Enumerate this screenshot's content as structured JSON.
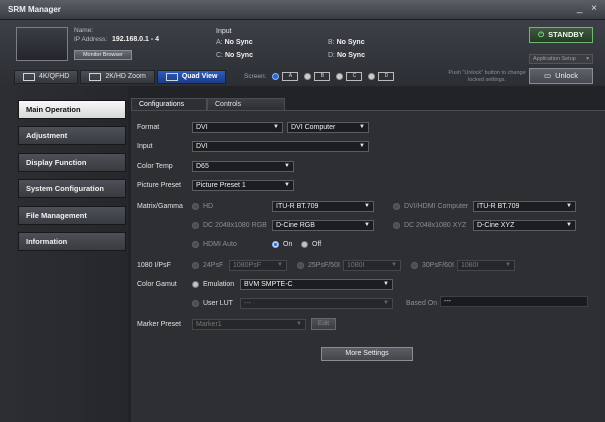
{
  "window": {
    "title": "SRM Manager",
    "minimize": "_",
    "close": "×"
  },
  "device": {
    "name_label": "Name:",
    "ip_label": "IP Address:",
    "ip_value": "192.168.0.1 - 4",
    "monitor_browser": "Monitor Browser"
  },
  "input_status": {
    "label": "Input",
    "a_label": "A:",
    "a_value": "No Sync",
    "b_label": "B:",
    "b_value": "No Sync",
    "c_label": "C:",
    "c_value": "No Sync",
    "d_label": "D:",
    "d_value": "No Sync"
  },
  "controls": {
    "standby": "STANDBY",
    "app_setup": "Application Setup",
    "unlock_hint": "Push \"Unlock\" button to change locked settings.",
    "unlock": "Unlock"
  },
  "view_tabs": [
    {
      "label": "4K/QFHD",
      "active": false
    },
    {
      "label": "2K/HD Zoom",
      "active": false
    },
    {
      "label": "Quad View",
      "active": true
    }
  ],
  "screen": {
    "label": "Screen:",
    "options": [
      "A",
      "B",
      "C",
      "D"
    ],
    "selected": "A"
  },
  "sidebar": {
    "items": [
      {
        "label": "Main Operation",
        "active": true
      },
      {
        "label": "Adjustment",
        "active": false
      },
      {
        "label": "Display Function",
        "active": false
      },
      {
        "label": "System Configuration",
        "active": false
      },
      {
        "label": "File Management",
        "active": false
      },
      {
        "label": "Information",
        "active": false
      }
    ]
  },
  "tabs": [
    {
      "label": "Configurations",
      "active": true
    },
    {
      "label": "Controls",
      "active": false
    }
  ],
  "form": {
    "format_label": "Format",
    "format_value": "DVI",
    "format_sub_value": "DVI Computer",
    "input_label": "Input",
    "input_value": "DVI",
    "colortemp_label": "Color Temp",
    "colortemp_value": "D65",
    "preset_label": "Picture Preset",
    "preset_value": "Picture Preset 1",
    "matrix_label": "Matrix/Gamma",
    "hd_label": "HD",
    "hd_value": "ITU-R BT.709",
    "dvihdmi_label": "DVI/HDMI Computer",
    "dvihdmi_value": "ITU-R BT.709",
    "dc_rgb_label": "DC 2048x1080 RGB",
    "dc_rgb_value": "D-Cine RGB",
    "dc_xyz_label": "DC 2048x1080 XYZ",
    "dc_xyz_value": "D-Cine XYZ",
    "hdmi_auto_label": "HDMI Auto",
    "on_label": "On",
    "off_label": "Off",
    "psf_label": "1080 I/PsF",
    "psf24_label": "24PsF",
    "psf24_value": "1080PsF",
    "psf25_label": "25PsF/50I",
    "psf25_value": "1080I",
    "psf30_label": "30PsF/60I",
    "psf30_value": "1080I",
    "gamut_label": "Color Gamut",
    "emulation_label": "Emulation",
    "emulation_value": "BVM SMPTE-C",
    "userlut_label": "User LUT",
    "userlut_value": "---",
    "basedon_label": "Based On",
    "basedon_value": "---",
    "marker_label": "Marker Preset",
    "marker_value": "Marker1",
    "edit_label": "Edit",
    "more_settings": "More Settings"
  }
}
